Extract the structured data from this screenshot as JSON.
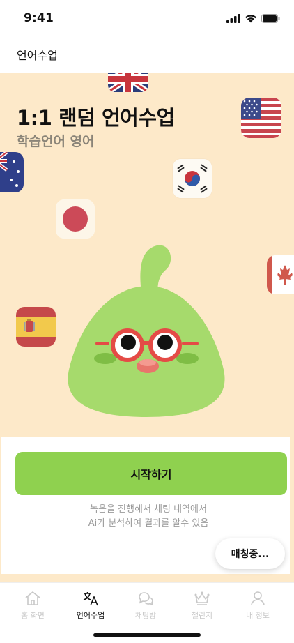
{
  "status_bar": {
    "time": "9:41",
    "icons": [
      "signal-icon",
      "wifi-icon",
      "battery-icon"
    ]
  },
  "header": {
    "title": "언어수업"
  },
  "hero": {
    "title": "1:1 랜덤 언어수업",
    "subtitle": "학습언어 영어",
    "flags": [
      "uk-flag-icon",
      "usa-flag-icon",
      "australia-flag-icon",
      "korea-flag-icon",
      "japan-flag-icon",
      "canada-flag-icon",
      "spain-flag-icon"
    ],
    "mascot": "green-blob-mascot-with-glasses"
  },
  "panel": {
    "start_label": "시작하기",
    "info_line1": "녹음을 진행해서 채팅 내역에서",
    "info_line2": "Ai가 분석하여 결과를 알수 있음",
    "matching_label": "매칭중..."
  },
  "tabs": [
    {
      "label": "홈 화면",
      "icon": "home-icon",
      "active": false
    },
    {
      "label": "언어수업",
      "icon": "translate-icon",
      "active": true
    },
    {
      "label": "채팅방",
      "icon": "chat-icon",
      "active": false
    },
    {
      "label": "챌린지",
      "icon": "crown-icon",
      "active": false
    },
    {
      "label": "내 정보",
      "icon": "user-icon",
      "active": false
    }
  ],
  "colors": {
    "accent": "#8fd14f",
    "hero_bg": "#fde9c9",
    "mascot": "#a6da6c",
    "glasses": "#e44b46"
  }
}
